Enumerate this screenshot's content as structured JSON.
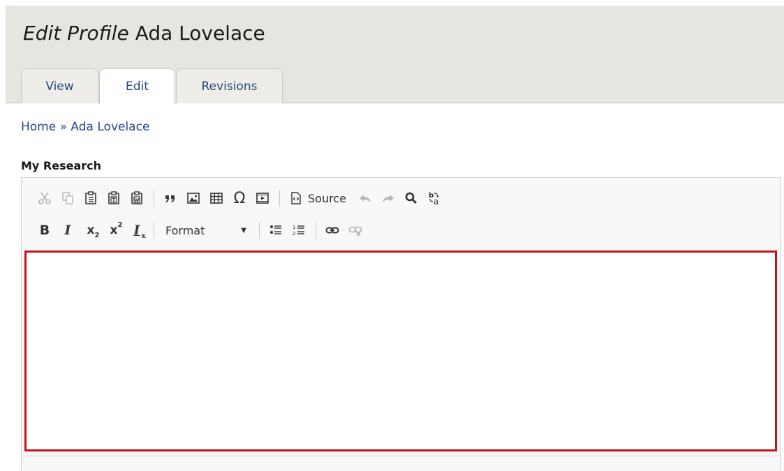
{
  "page": {
    "title_italic": "Edit Profile",
    "title_name": "Ada Lovelace"
  },
  "tabs": [
    {
      "label": "View",
      "active": false
    },
    {
      "label": "Edit",
      "active": true
    },
    {
      "label": "Revisions",
      "active": false
    }
  ],
  "breadcrumb": {
    "home": "Home",
    "separator": "»",
    "current": "Ada Lovelace"
  },
  "field": {
    "label": "My Research"
  },
  "editor": {
    "toolbar_row1": [
      "cut-icon",
      "copy-icon",
      "paste-icon",
      "paste-text-icon",
      "paste-word-icon",
      "blockquote-icon",
      "image-icon",
      "table-icon",
      "special-char-icon",
      "media-embed-icon",
      "source-icon",
      "undo-icon",
      "redo-icon",
      "find-icon",
      "replace-icon"
    ],
    "source_label": "Source",
    "toolbar_row2": [
      "bold-icon",
      "italic-icon",
      "subscript-icon",
      "superscript-icon",
      "remove-format-icon",
      "bulleted-list-icon",
      "numbered-list-icon",
      "link-icon",
      "unlink-icon"
    ],
    "format_label": "Format",
    "content": "",
    "highlight_color": "#c8101a"
  },
  "colors": {
    "header_bg": "#e6e5df",
    "link": "#244a86"
  }
}
